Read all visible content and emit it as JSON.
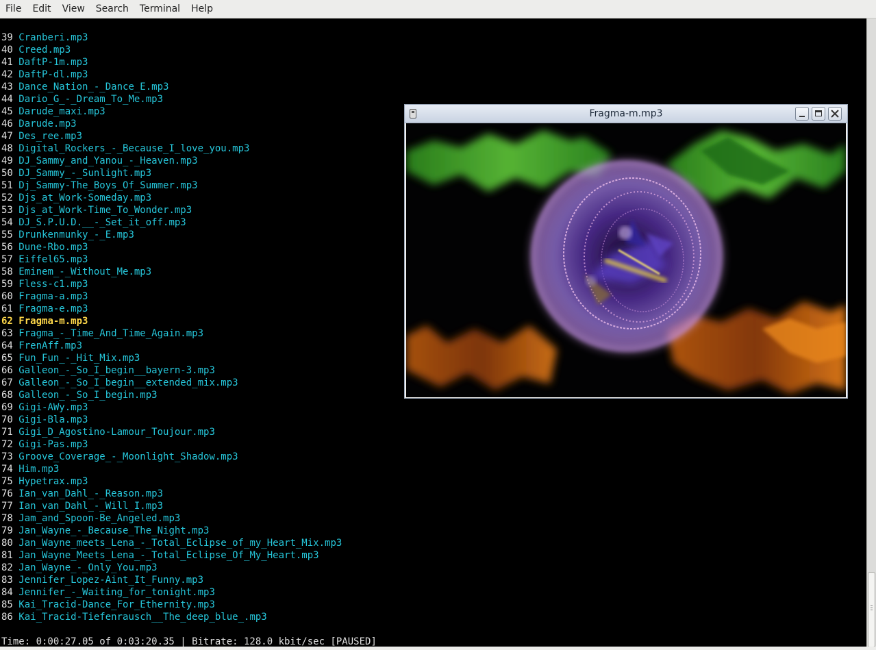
{
  "menu": [
    "File",
    "Edit",
    "View",
    "Search",
    "Terminal",
    "Help"
  ],
  "playlist": [
    {
      "num": "39",
      "name": "Cranberi.mp3"
    },
    {
      "num": "40",
      "name": "Creed.mp3"
    },
    {
      "num": "41",
      "name": "DaftP-1m.mp3"
    },
    {
      "num": "42",
      "name": "DaftP-dl.mp3"
    },
    {
      "num": "43",
      "name": "Dance_Nation_-_Dance_E.mp3"
    },
    {
      "num": "44",
      "name": "Dario_G_-_Dream_To_Me.mp3"
    },
    {
      "num": "45",
      "name": "Darude_maxi.mp3"
    },
    {
      "num": "46",
      "name": "Darude.mp3"
    },
    {
      "num": "47",
      "name": "Des_ree.mp3"
    },
    {
      "num": "48",
      "name": "Digital_Rockers_-_Because_I_love_you.mp3"
    },
    {
      "num": "49",
      "name": "DJ_Sammy_and_Yanou_-_Heaven.mp3"
    },
    {
      "num": "50",
      "name": "DJ_Sammy_-_Sunlight.mp3"
    },
    {
      "num": "51",
      "name": "Dj_Sammy-The_Boys_Of_Summer.mp3"
    },
    {
      "num": "52",
      "name": "Djs_at_Work-Someday.mp3"
    },
    {
      "num": "53",
      "name": "Djs_at_Work-Time_To_Wonder.mp3"
    },
    {
      "num": "54",
      "name": "DJ_S.P.U.D.__-_Set_it_off.mp3"
    },
    {
      "num": "55",
      "name": "Drunkenmunky_-_E.mp3"
    },
    {
      "num": "56",
      "name": "Dune-Rbo.mp3"
    },
    {
      "num": "57",
      "name": "Eiffel65.mp3"
    },
    {
      "num": "58",
      "name": "Eminem_-_Without_Me.mp3"
    },
    {
      "num": "59",
      "name": "Fless-c1.mp3"
    },
    {
      "num": "60",
      "name": "Fragma-a.mp3"
    },
    {
      "num": "61",
      "name": "Fragma-e.mp3"
    },
    {
      "num": "62",
      "name": "Fragma-m.mp3",
      "current": true
    },
    {
      "num": "63",
      "name": "Fragma_-_Time_And_Time_Again.mp3"
    },
    {
      "num": "64",
      "name": "FrenAff.mp3"
    },
    {
      "num": "65",
      "name": "Fun_Fun_-_Hit_Mix.mp3"
    },
    {
      "num": "66",
      "name": "Galleon_-_So_I_begin__bayern-3.mp3"
    },
    {
      "num": "67",
      "name": "Galleon_-_So_I_begin__extended_mix.mp3"
    },
    {
      "num": "68",
      "name": "Galleon_-_So_I_begin.mp3"
    },
    {
      "num": "69",
      "name": "Gigi-AWy.mp3"
    },
    {
      "num": "70",
      "name": "Gigi-Bla.mp3"
    },
    {
      "num": "71",
      "name": "Gigi_D_Agostino-Lamour_Toujour.mp3"
    },
    {
      "num": "72",
      "name": "Gigi-Pas.mp3"
    },
    {
      "num": "73",
      "name": "Groove_Coverage_-_Moonlight_Shadow.mp3"
    },
    {
      "num": "74",
      "name": "Him.mp3"
    },
    {
      "num": "75",
      "name": "Hypetrax.mp3"
    },
    {
      "num": "76",
      "name": "Ian_van_Dahl_-_Reason.mp3"
    },
    {
      "num": "77",
      "name": "Ian_van_Dahl_-_Will_I.mp3"
    },
    {
      "num": "78",
      "name": "Jam_and_Spoon-Be_Angeled.mp3"
    },
    {
      "num": "79",
      "name": "Jan_Wayne_-_Because_The_Night.mp3"
    },
    {
      "num": "80",
      "name": "Jan_Wayne_meets_Lena_-_Total_Eclipse_of_my_Heart_Mix.mp3"
    },
    {
      "num": "81",
      "name": "Jan_Wayne_Meets_Lena_-_Total_Eclipse_Of_My_Heart.mp3"
    },
    {
      "num": "82",
      "name": "Jan_Wayne_-_Only_You.mp3"
    },
    {
      "num": "83",
      "name": "Jennifer_Lopez-Aint_It_Funny.mp3"
    },
    {
      "num": "84",
      "name": "Jennifer_-_Waiting_for_tonight.mp3"
    },
    {
      "num": "85",
      "name": "Kai_Tracid-Dance_For_Ethernity.mp3"
    },
    {
      "num": "86",
      "name": "Kai_Tracid-Tiefenrausch__The_deep_blue_.mp3"
    }
  ],
  "status": "Time: 0:00:27.05 of 0:03:20.35 | Bitrate: 128.0 kbit/sec [PAUSED]",
  "viz": {
    "title": "Fragma-m.mp3",
    "icons": {
      "app": "app-icon",
      "minimize": "minimize-icon",
      "maximize": "maximize-icon",
      "close": "close-icon"
    }
  },
  "colors": {
    "filename": "#26c6da",
    "number": "#e0e0e0",
    "current": "#ffd84a",
    "background": "#000000"
  }
}
